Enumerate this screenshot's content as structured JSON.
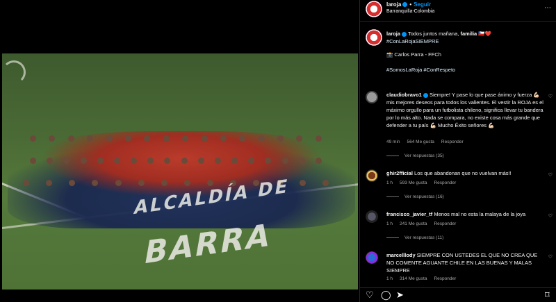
{
  "header": {
    "username": "laroja",
    "separator": "•",
    "follow_label": "Seguir",
    "location": "Barranquilla-Colombia",
    "more_icon": "more-icon"
  },
  "photo": {
    "field_text_1": "ALCALDÍA DE",
    "field_text_2": "BARRA"
  },
  "caption": {
    "username": "laroja",
    "text_1": "Todos juntos mañana,",
    "text_bold": "familia",
    "text_2": "🇨🇱❤️",
    "hashtag_1": "#ConLaRojaSIEMPRE",
    "credit": "📸 Carlos Parra - FFCh",
    "tags": "#SomosLaRoja #ConRespeto"
  },
  "comments": [
    {
      "username": "claudiobravo1",
      "text": "Siempre! Y pase lo que pase ánimo y fuerza 💪🏻 mis mejores deseos para todos los valientes. El vestir la ROJA es el máximo orgullo para un futbolista chileno, significa llevar tu bandera por lo más alto. Nada se compara, no existe cosa más grande que defender a tu país 💪🏻 Mucho Éxito señores 💪🏻",
      "time": "49 min",
      "likes": "564 Me gusta",
      "reply": "Responder",
      "replies": "Ver respuestas (35)"
    },
    {
      "username": "ghir2fficial",
      "text": "Los que abandonan que no vuelvan más!!",
      "time": "1 h",
      "likes": "593 Me gusta",
      "reply": "Responder",
      "replies": "Ver respuestas (16)"
    },
    {
      "username": "francisco_javier_tf",
      "text": "Menos mal no esta la malaya de la joya",
      "time": "1 h",
      "likes": "241 Me gusta",
      "reply": "Responder",
      "replies": "Ver respuestas (11)"
    },
    {
      "username": "marcelllody",
      "text": "SIEMPRE CON USTEDES EL QUE NO CREA QUE NO COMENTE AGUANTE CHILE EN LAS BUENAS Y MALAS SIEMPRE",
      "time": "1 h",
      "likes": "314 Me gusta",
      "reply": "Responder",
      "replies": ""
    }
  ],
  "actions": {
    "like_icon": "heart-icon",
    "comment_icon": "comment-icon",
    "share_icon": "share-icon",
    "save_icon": "bookmark-icon"
  }
}
